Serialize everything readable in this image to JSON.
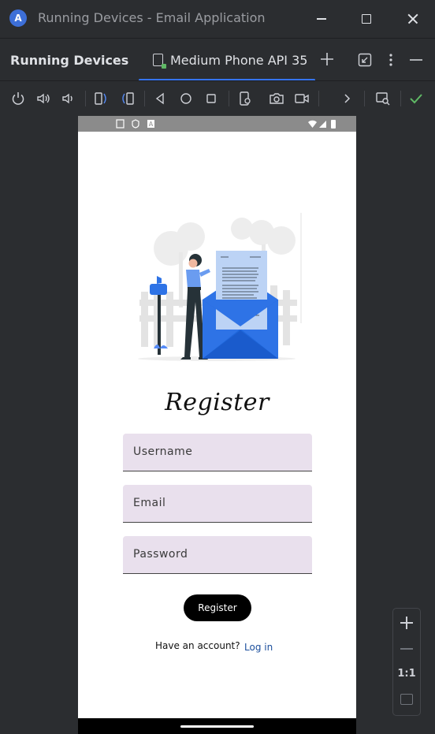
{
  "window": {
    "title": "Running Devices - Email Application"
  },
  "header": {
    "panel_title": "Running Devices",
    "tab_label": "Medium Phone API 35"
  },
  "app": {
    "heading": "Register",
    "fields": {
      "username": "Username",
      "email": "Email",
      "password": "Password"
    },
    "register_button": "Register",
    "have_account": "Have an account?",
    "login_link": "Log in"
  },
  "zoom": {
    "actual_size_label": "1:1"
  },
  "colors": {
    "accent": "#3574f0",
    "field_bg": "#e9e0ed",
    "link": "#1b4e9c",
    "success": "#5fb865"
  }
}
